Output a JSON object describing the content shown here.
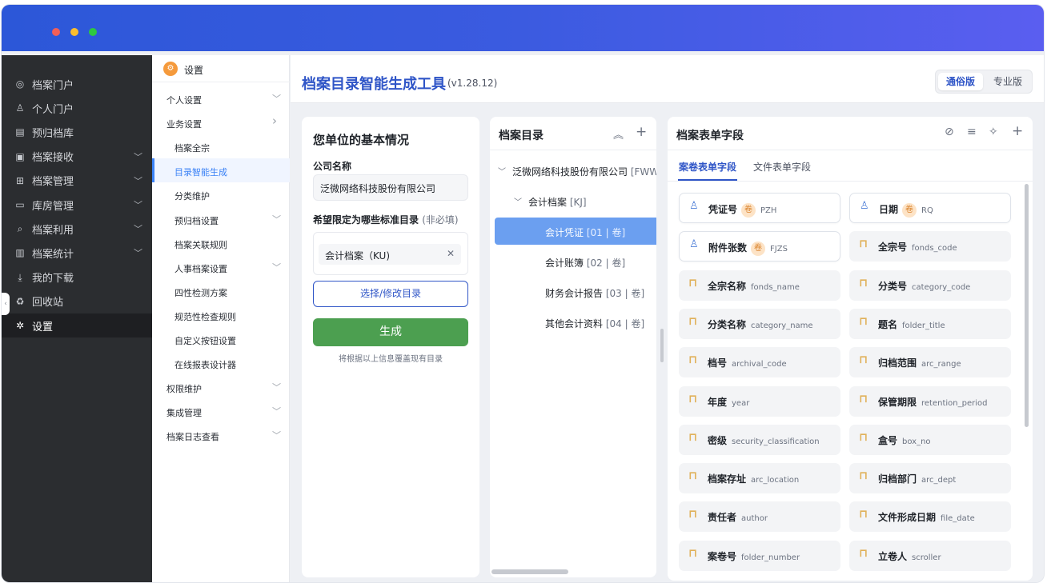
{
  "nav": {
    "items": [
      {
        "label": "档案门户",
        "icon": "portal-icon",
        "glyph": "◎",
        "chevron": false
      },
      {
        "label": "个人门户",
        "icon": "user-icon",
        "glyph": "♙",
        "chevron": false
      },
      {
        "label": "预归档库",
        "icon": "archive-icon",
        "glyph": "▤",
        "chevron": false
      },
      {
        "label": "档案接收",
        "icon": "receive-icon",
        "glyph": "▣",
        "chevron": true
      },
      {
        "label": "档案管理",
        "icon": "grid-icon",
        "glyph": "⊞",
        "chevron": true
      },
      {
        "label": "库房管理",
        "icon": "storage-icon",
        "glyph": "▭",
        "chevron": true
      },
      {
        "label": "档案利用",
        "icon": "search-doc-icon",
        "glyph": "⌕",
        "chevron": true
      },
      {
        "label": "档案统计",
        "icon": "chart-icon",
        "glyph": "▥",
        "chevron": true
      },
      {
        "label": "我的下载",
        "icon": "download-icon",
        "glyph": "⤓",
        "chevron": false
      },
      {
        "label": "回收站",
        "icon": "trash-icon",
        "glyph": "♻",
        "chevron": false
      },
      {
        "label": "设置",
        "icon": "gear-icon",
        "glyph": "✲",
        "chevron": false,
        "active": true
      }
    ]
  },
  "subnav": {
    "title": "设置",
    "items": [
      {
        "label": "个人设置",
        "level": 1,
        "chevron": "down"
      },
      {
        "label": "业务设置",
        "level": 1,
        "chevron": "right"
      },
      {
        "label": "档案全宗",
        "level": 2
      },
      {
        "label": "目录智能生成",
        "level": 2,
        "active": true
      },
      {
        "label": "分类维护",
        "level": 2
      },
      {
        "label": "预归档设置",
        "level": 2,
        "chevron": "down"
      },
      {
        "label": "档案关联规则",
        "level": 2
      },
      {
        "label": "人事档案设置",
        "level": 2,
        "chevron": "down"
      },
      {
        "label": "四性检测方案",
        "level": 2
      },
      {
        "label": "规范性检查规则",
        "level": 2
      },
      {
        "label": "自定义按钮设置",
        "level": 2
      },
      {
        "label": "在线报表设计器",
        "level": 2
      },
      {
        "label": "权限维护",
        "level": 1,
        "chevron": "down"
      },
      {
        "label": "集成管理",
        "level": 1,
        "chevron": "down"
      },
      {
        "label": "档案日志查看",
        "level": 1,
        "chevron": "down"
      }
    ]
  },
  "header": {
    "title": "档案目录智能生成工具",
    "version": "(v1.28.12)",
    "mode_common": "通俗版",
    "mode_pro": "专业版"
  },
  "basic": {
    "heading": "您单位的基本情况",
    "company_label": "公司名称",
    "company_value": "泛微网络科技股份有限公司",
    "limit_label": "希望限定为哪些标准目录",
    "limit_optional": "(非必填)",
    "tag": "会计档案（KU)",
    "tag_close": "✕",
    "select_button": "选择/修改目录",
    "generate_button": "生成",
    "hint": "将根据以上信息覆盖现有目录"
  },
  "catalog": {
    "title": "档案目录",
    "collapse_glyph": "︽",
    "add_glyph": "+",
    "tree": [
      {
        "label": "泛微网络科技股份有限公司",
        "code": "[FWW",
        "depth": 0,
        "arrow": "﹀"
      },
      {
        "label": "会计档案",
        "code": "[KJ]",
        "depth": 1,
        "arrow": "﹀"
      },
      {
        "label": "会计凭证",
        "code": "[01 | 卷]",
        "depth": 2,
        "selected": true
      },
      {
        "label": "会计账簿",
        "code": "[02 | 卷]",
        "depth": 2
      },
      {
        "label": "财务会计报告",
        "code": "[03 | 卷]",
        "depth": 2
      },
      {
        "label": "其他会计资料",
        "code": "[04 | 卷]",
        "depth": 2
      }
    ]
  },
  "fields": {
    "title": "档案表单字段",
    "tabs": [
      "案卷表单字段",
      "文件表单字段"
    ],
    "header_icons": [
      {
        "name": "hide-icon",
        "glyph": "⊘"
      },
      {
        "name": "list-icon",
        "glyph": "≡"
      },
      {
        "name": "sparkle-icon",
        "glyph": "✧"
      },
      {
        "name": "add-icon",
        "glyph": "+"
      }
    ],
    "badge": "卷",
    "items": [
      {
        "name": "凭证号",
        "code": "PZH",
        "type": "user",
        "badge": true
      },
      {
        "name": "日期",
        "code": "RQ",
        "type": "user",
        "badge": true
      },
      {
        "name": "附件张数",
        "code": "FJZS",
        "type": "user",
        "badge": true
      },
      {
        "name": "全宗号",
        "code": "fonds_code",
        "type": "lock"
      },
      {
        "name": "全宗名称",
        "code": "fonds_name",
        "type": "lock"
      },
      {
        "name": "分类号",
        "code": "category_code",
        "type": "lock"
      },
      {
        "name": "分类名称",
        "code": "category_name",
        "type": "lock"
      },
      {
        "name": "题名",
        "code": "folder_title",
        "type": "lock"
      },
      {
        "name": "档号",
        "code": "archival_code",
        "type": "lock"
      },
      {
        "name": "归档范围",
        "code": "arc_range",
        "type": "lock"
      },
      {
        "name": "年度",
        "code": "year",
        "type": "lock"
      },
      {
        "name": "保管期限",
        "code": "retention_period",
        "type": "lock"
      },
      {
        "name": "密级",
        "code": "security_classification",
        "type": "lock"
      },
      {
        "name": "盒号",
        "code": "box_no",
        "type": "lock"
      },
      {
        "name": "档案存址",
        "code": "arc_location",
        "type": "lock"
      },
      {
        "name": "归档部门",
        "code": "arc_dept",
        "type": "lock"
      },
      {
        "name": "责任者",
        "code": "author",
        "type": "lock"
      },
      {
        "name": "文件形成日期",
        "code": "file_date",
        "type": "lock"
      },
      {
        "name": "案卷号",
        "code": "folder_number",
        "type": "lock"
      },
      {
        "name": "立卷人",
        "code": "scroller",
        "type": "lock"
      }
    ]
  },
  "colors": {
    "accent": "#2f55c7",
    "generate": "#4c9f50",
    "selected_row": "#6b9ff0",
    "nav_bg": "#2b2d30"
  }
}
